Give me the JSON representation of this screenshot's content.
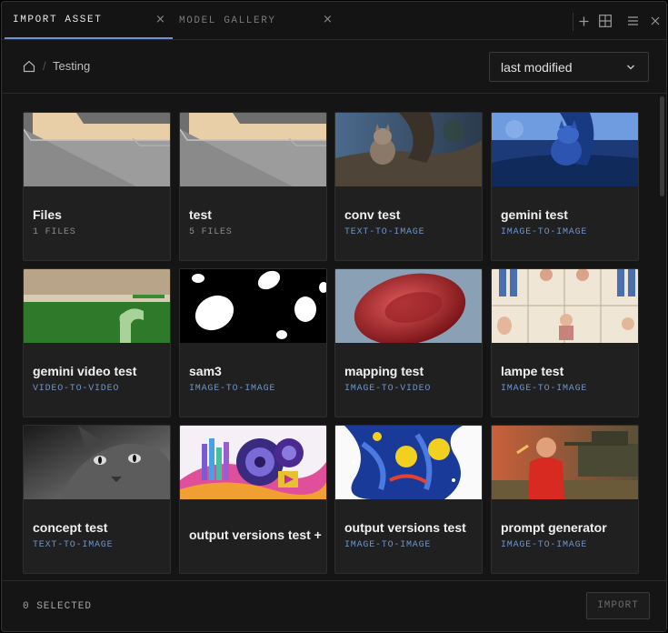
{
  "tabs": [
    {
      "label": "IMPORT ASSET",
      "active": true,
      "close": "×"
    },
    {
      "label": "MODEL GALLERY",
      "active": false,
      "close": "×"
    }
  ],
  "toolbar_icons": [
    "plus-icon",
    "grid-layout-icon",
    "menu-icon",
    "close-icon"
  ],
  "breadcrumb": {
    "home_icon": "home-icon",
    "separator": "/",
    "current": "Testing"
  },
  "sort": {
    "value": "last modified",
    "icon": "chevron-down-icon"
  },
  "cards": [
    {
      "title": "Files",
      "subtitle": "1 FILES",
      "kind": "folder"
    },
    {
      "title": "test",
      "subtitle": "5 FILES",
      "kind": "folder"
    },
    {
      "title": "conv test",
      "subtitle": "TEXT-TO-IMAGE",
      "kind": "asset"
    },
    {
      "title": "gemini test",
      "subtitle": "IMAGE-TO-IMAGE",
      "kind": "asset"
    },
    {
      "title": "gemini video test",
      "subtitle": "VIDEO-TO-VIDEO",
      "kind": "asset"
    },
    {
      "title": "sam3",
      "subtitle": "IMAGE-TO-IMAGE",
      "kind": "asset"
    },
    {
      "title": "mapping test",
      "subtitle": "IMAGE-TO-VIDEO",
      "kind": "asset"
    },
    {
      "title": "lampe test",
      "subtitle": "IMAGE-TO-IMAGE",
      "kind": "asset"
    },
    {
      "title": "concept test",
      "subtitle": "TEXT-TO-IMAGE",
      "kind": "asset"
    },
    {
      "title": "output versions test +",
      "subtitle": "",
      "kind": "asset"
    },
    {
      "title": "output versions test",
      "subtitle": "IMAGE-TO-IMAGE",
      "kind": "asset"
    },
    {
      "title": "prompt generator",
      "subtitle": "IMAGE-TO-IMAGE",
      "kind": "asset"
    }
  ],
  "footer": {
    "selected": "0 SELECTED",
    "import_label": "IMPORT"
  },
  "colors": {
    "accent": "#6b93d6",
    "type_label": "#6f93c9",
    "background": "#151515",
    "card": "#202020"
  }
}
